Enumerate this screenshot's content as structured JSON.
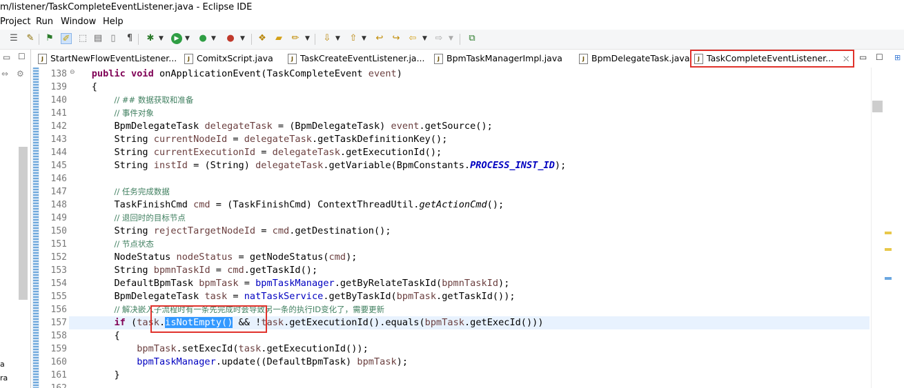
{
  "window": {
    "title": "m/listener/TaskCompleteEventListener.java - Eclipse IDE"
  },
  "menu": [
    "Project",
    "Run",
    "Window",
    "Help"
  ],
  "toolbar": {
    "icons": [
      "format-icon",
      "toggle-comment-icon",
      "bookmark-icon",
      "mark-occurrences-icon",
      "block-select-icon",
      "show-whitespace-icon",
      "pilcrow-icon",
      "debug-icon",
      "run-icon",
      "coverage-icon",
      "external-tools-icon",
      "open-type-icon",
      "open-folder-icon",
      "search-icon",
      "next-annotation-icon",
      "prev-annotation-icon",
      "last-edit-icon",
      "forward-icon",
      "back-icon",
      "forward-nav-icon",
      "pin-editor-icon"
    ]
  },
  "left_pane": {
    "bottom_text": [
      "a",
      "ra"
    ]
  },
  "tabs": [
    {
      "label": "StartNewFlowEventListener...",
      "active": false
    },
    {
      "label": "ComitxScript.java",
      "active": false
    },
    {
      "label": "TaskCreateEventListener.ja...",
      "active": false
    },
    {
      "label": "BpmTaskManagerImpl.java",
      "active": false
    },
    {
      "label": "BpmDelegateTask.java",
      "active": false
    },
    {
      "label": "TaskCompleteEventListener...",
      "active": true,
      "close": "⛌"
    }
  ],
  "editor": {
    "line_numbers": [
      "138",
      "139",
      "140",
      "141",
      "142",
      "143",
      "144",
      "145",
      "146",
      "147",
      "148",
      "149",
      "150",
      "151",
      "152",
      "153",
      "154",
      "155",
      "156",
      "157",
      "158",
      "159",
      "160",
      "161",
      "162"
    ],
    "current_line": "157",
    "code": {
      "l138": {
        "kw1": "public",
        "kw2": "void",
        "rest": " onApplicationEvent(TaskCompleteEvent ",
        "var": "event",
        "end": ")"
      },
      "l139": "{",
      "l140": "// ## 数据获取和准备",
      "l141": "// 事件对象",
      "l142": {
        "a": "BpmDelegateTask ",
        "b": "delegateTask",
        "c": " = (BpmDelegateTask) ",
        "d": "event",
        "e": ".getSource();"
      },
      "l143": {
        "a": "String ",
        "b": "currentNodeId",
        "c": " = ",
        "d": "delegateTask",
        "e": ".getTaskDefinitionKey();"
      },
      "l144": {
        "a": "String ",
        "b": "currentExecutionId",
        "c": " = ",
        "d": "delegateTask",
        "e": ".getExecutionId();"
      },
      "l145": {
        "a": "String ",
        "b": "instId",
        "c": " = (String) ",
        "d": "delegateTask",
        "e": ".getVariable(BpmConstants.",
        "f": "PROCESS_INST_ID",
        "g": ");"
      },
      "l147": "// 任务完成数据",
      "l148": {
        "a": "TaskFinishCmd ",
        "b": "cmd",
        "c": " = (TaskFinishCmd) ContextThreadUtil.",
        "d": "getActionCmd",
        "e": "();"
      },
      "l149": "// 退回时的目标节点",
      "l150": {
        "a": "String ",
        "b": "rejectTargetNodeId",
        "c": " = ",
        "d": "cmd",
        "e": ".getDestination();"
      },
      "l151": "// 节点状态",
      "l152": {
        "a": "NodeStatus ",
        "b": "nodeStatus",
        "c": " = getNodeStatus(",
        "d": "cmd",
        "e": ");"
      },
      "l153": {
        "a": "String ",
        "b": "bpmnTaskId",
        "c": " = ",
        "d": "cmd",
        "e": ".getTaskId();"
      },
      "l154": {
        "a": "DefaultBpmTask ",
        "b": "bpmTask",
        "c": " = ",
        "d": "bpmTaskManager",
        "e": ".getByRelateTaskId(",
        "f": "bpmnTaskId",
        "g": ");"
      },
      "l155": {
        "a": "BpmDelegateTask ",
        "b": "task",
        "c": " = ",
        "d": "natTaskService",
        "e": ".getByTaskId(",
        "f": "bpmTask",
        "g": ".getTaskId());"
      },
      "l156": "// 解决嵌入子流程时有一条先完成时会导致另一条的执行ID变化了，需要更新",
      "l157": {
        "kw": "if",
        "a": " (",
        "b": "task",
        "c": ".",
        "sel": "isNotEmpty()",
        "d": " && !",
        "e": "task",
        "f": ".getExecutionId().equals(",
        "g": "bpmTask",
        "h": ".getExecId()))"
      },
      "l158": "{",
      "l159": {
        "a": "bpmTask",
        "b": ".setExecId(",
        "c": "task",
        "d": ".getExecutionId());"
      },
      "l160": {
        "a": "bpmTaskManager",
        "b": ".update((DefaultBpmTask) ",
        "c": "bpmTask",
        "d": ");"
      },
      "l161": "}"
    }
  },
  "colors": {
    "keyword": "#7f0055",
    "comment": "#3f7f5f",
    "field": "#0000c0",
    "local": "#6a3e3e",
    "highlight_box": "#e0312a",
    "selection": "#3399ff"
  }
}
